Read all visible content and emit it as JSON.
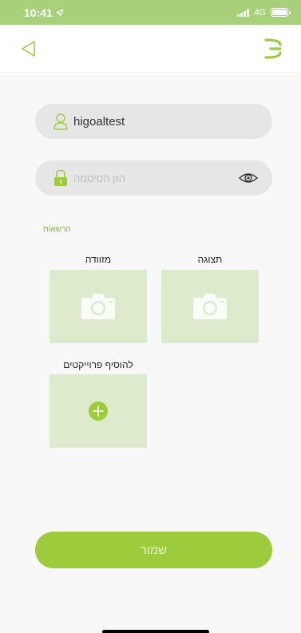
{
  "status_bar": {
    "time": "10:41",
    "network": "4G"
  },
  "colors": {
    "accent": "#9ccc3c",
    "status_bar": "#a6d07a",
    "tile": "#dcebcc",
    "field": "#e6e6e6"
  },
  "header": {
    "back_icon": "back-triangle-icon",
    "logo_icon": "app-logo-icon"
  },
  "form": {
    "username_value": "higoaltest",
    "username_icon": "user-icon",
    "password_placeholder": "הזן הסיסמה",
    "password_icon": "lock-icon",
    "visibility_icon": "eye-icon"
  },
  "permissions": {
    "label": "הרשאות",
    "tiles": [
      {
        "label": "תצוגה",
        "icon": "camera-icon"
      },
      {
        "label": "מזוודה",
        "icon": "camera-icon"
      },
      {
        "label": "להוסיף פרוייקטים",
        "icon": "plus-icon"
      }
    ]
  },
  "save_button": {
    "label": "שמור"
  }
}
